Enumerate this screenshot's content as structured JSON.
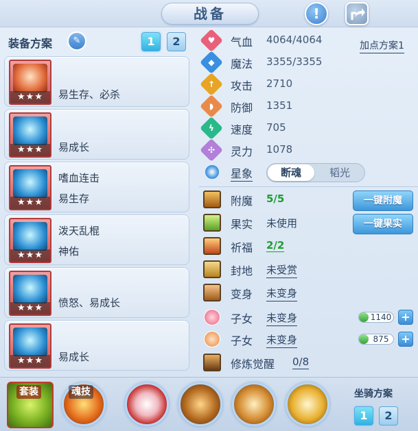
{
  "header": {
    "title": "战备",
    "help_icon": "exclamation-icon",
    "share_icon": "share-icon"
  },
  "scheme": {
    "label": "装备方案",
    "tabs": [
      "1",
      "2"
    ],
    "active_tab": "1"
  },
  "cards": [
    {
      "line1": "",
      "line2": "易生存、必杀",
      "stars": "★★★"
    },
    {
      "line1": "",
      "line2": "易成长",
      "stars": "★★★"
    },
    {
      "line1": "嗜血连击",
      "line2": "易生存",
      "stars": "★★★"
    },
    {
      "line1": "泼天乱棍",
      "line2": "神佑",
      "stars": "★★★"
    },
    {
      "line1": "",
      "line2": "愤怒、易成长",
      "stars": "★★★"
    },
    {
      "line1": "",
      "line2": "易成长",
      "stars": "★★★"
    }
  ],
  "stats": [
    {
      "name": "气血",
      "value": "4064/4064",
      "color": "#e9607a"
    },
    {
      "name": "魔法",
      "value": "3355/3355",
      "color": "#3a8fe0"
    },
    {
      "name": "攻击",
      "value": "2710",
      "color": "#e8a425"
    },
    {
      "name": "防御",
      "value": "1351",
      "color": "#e98a4b"
    },
    {
      "name": "速度",
      "value": "705",
      "color": "#29b98a"
    },
    {
      "name": "灵力",
      "value": "1078",
      "color": "#b27fd9"
    }
  ],
  "add_point_plan": "加点方案1",
  "xingxiang": {
    "label": "星象",
    "options": [
      "断魂",
      "韬光"
    ],
    "active": "断魂"
  },
  "lower": {
    "fumo": {
      "label": "附魔",
      "value": "5/5",
      "button": "一键附魔"
    },
    "guoshi": {
      "label": "果实",
      "value": "未使用",
      "button": "一键果实"
    },
    "qifu": {
      "label": "祈福",
      "value": "2/2"
    },
    "fengdi": {
      "label": "封地",
      "value": "未受赏"
    },
    "bianshen": {
      "label": "变身",
      "value": "未变身"
    },
    "zinv1": {
      "label": "子女",
      "value": "未变身",
      "resource": "1140"
    },
    "zinv2": {
      "label": "子女",
      "value": "未变身",
      "resource": "875"
    },
    "xiulian": {
      "label": "修炼觉醒",
      "value": "0/8"
    }
  },
  "bottom": {
    "suit_label": "套装",
    "soul_label": "魂技",
    "mount_label": "坐骑方案",
    "mount_tabs": [
      "1",
      "2"
    ]
  }
}
